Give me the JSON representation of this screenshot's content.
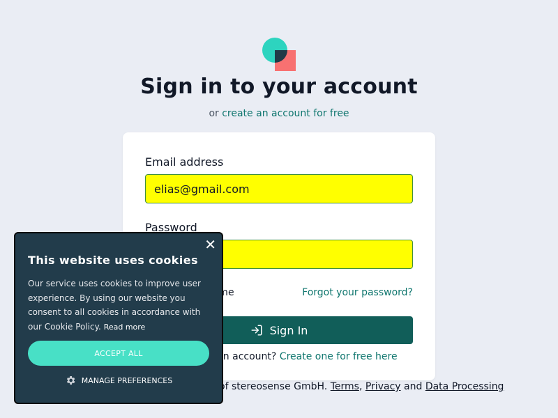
{
  "header": {
    "title": "Sign in to your account",
    "subtitle_prefix": "or",
    "subtitle_link": "create an account for free"
  },
  "form": {
    "email_label": "Email address",
    "email_value": "elias@gmail.com",
    "password_label": "Password",
    "remember_label": "Remember me",
    "forgot_label": "Forgot your password?",
    "signin_label": "Sign In",
    "no_account_prefix": "Don't have an account?",
    "no_account_link": "Create one for free here"
  },
  "footer": {
    "text": "is a trademark of stereosense GmbH.",
    "terms": "Terms",
    "privacy": "Privacy",
    "and": "and",
    "data_processing": "Data Processing"
  },
  "cookie": {
    "close": "✕",
    "title": "This website uses cookies",
    "body": "Our service uses cookies to improve user experience. By using our website you consent to all cookies in accordance with our Cookie Policy.",
    "read_more": "Read more",
    "accept_label": "ACCEPT ALL",
    "manage_label": "MANAGE PREFERENCES"
  },
  "colors": {
    "logo_circle": "#2dd4bf",
    "logo_square": "#f87171",
    "accent": "#0f766e",
    "button": "#115e59",
    "cookie_bg": "#223c4b",
    "cookie_accept": "#48e0c6",
    "input_autofill": "#ffff00"
  },
  "icons": {
    "logo": "logo-shapes-icon",
    "signin": "login-arrow-icon",
    "manage": "gear-icon",
    "close": "close-icon"
  }
}
